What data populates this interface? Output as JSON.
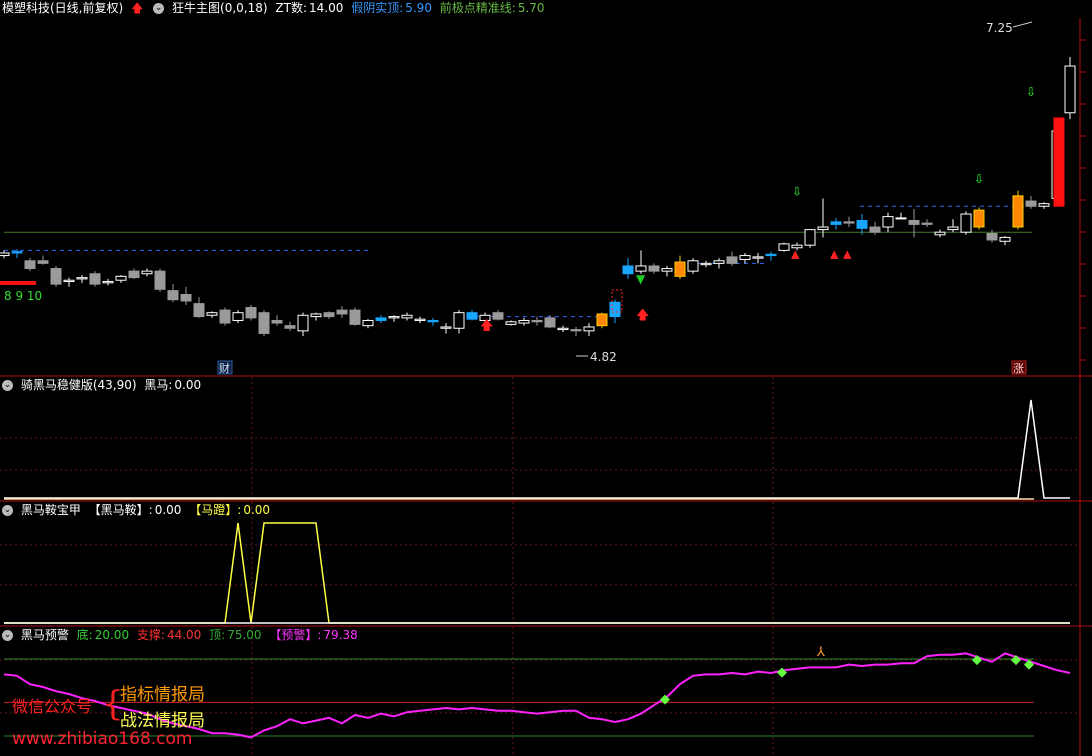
{
  "header": {
    "stock": "模塑科技(日线,前复权)",
    "indicator": "狂牛主图(0,0,18)",
    "zt_label": "ZT数:",
    "zt_value": "14.00",
    "fake_label": "假阴实顶:",
    "fake_value": "5.90",
    "prev_label": "前极点精准线:",
    "prev_value": "5.70"
  },
  "main_pane": {
    "high_label": "7.25",
    "low_label": "4.82",
    "counter": "8 9 10",
    "badge_cai": "财",
    "badge_zhang": "涨",
    "ylim": [
      4.6,
      7.35
    ]
  },
  "pane2": {
    "title": "骑黑马稳健版(43,90)",
    "label": "黑马:",
    "value": "0.00"
  },
  "pane3": {
    "title": "黑马鞍宝甲",
    "label1": "【黑马鞍】:",
    "value1": "0.00",
    "label2": "【马蹬】:",
    "value2": "0.00"
  },
  "pane4": {
    "title": "黑马预警",
    "bottom_label": "底:",
    "bottom_value": "20.00",
    "support_label": "支撑:",
    "support_value": "44.00",
    "top_label": "顶:",
    "top_value": "75.00",
    "warn_label": "【预警】:",
    "warn_value": "79.38"
  },
  "watermark": {
    "wechat": "微信公众号",
    "brace": "{",
    "line1": "指标情报局",
    "line2": "战法情报局",
    "url": "www.zhibiao168.com"
  },
  "colors": {
    "up": "#ffffff",
    "down": "#9a9a9a",
    "hot": "#ff8800",
    "red": "#ff1111",
    "cyan": "#19a6ff",
    "grid": "#6a1a1a",
    "magenta": "#ff22ff",
    "yellow": "#ffff44"
  },
  "chart_data": [
    {
      "type": "candlestick",
      "title": "模塑科技(日线,前复权)",
      "ohlc": [
        [
          5.52,
          5.56,
          5.5,
          5.54
        ],
        [
          5.54,
          5.57,
          5.5,
          5.55
        ],
        [
          5.48,
          5.5,
          5.4,
          5.42
        ],
        [
          5.48,
          5.52,
          5.45,
          5.46
        ],
        [
          5.42,
          5.44,
          5.28,
          5.3
        ],
        [
          5.32,
          5.35,
          5.28,
          5.33
        ],
        [
          5.34,
          5.37,
          5.31,
          5.35
        ],
        [
          5.38,
          5.4,
          5.28,
          5.3
        ],
        [
          5.31,
          5.34,
          5.29,
          5.32
        ],
        [
          5.33,
          5.37,
          5.31,
          5.36
        ],
        [
          5.4,
          5.42,
          5.34,
          5.35
        ],
        [
          5.38,
          5.42,
          5.36,
          5.4
        ],
        [
          5.4,
          5.42,
          5.24,
          5.26
        ],
        [
          5.25,
          5.3,
          5.16,
          5.18
        ],
        [
          5.22,
          5.28,
          5.14,
          5.17
        ],
        [
          5.15,
          5.2,
          5.04,
          5.05
        ],
        [
          5.06,
          5.09,
          5.04,
          5.08
        ],
        [
          5.1,
          5.12,
          4.98,
          5.0
        ],
        [
          5.02,
          5.1,
          5.0,
          5.08
        ],
        [
          5.12,
          5.14,
          5.02,
          5.04
        ],
        [
          5.08,
          5.1,
          4.9,
          4.92
        ],
        [
          5.02,
          5.06,
          4.98,
          5.0
        ],
        [
          4.98,
          5.01,
          4.94,
          4.96
        ],
        [
          4.94,
          5.08,
          4.9,
          5.06
        ],
        [
          5.05,
          5.08,
          5.02,
          5.07
        ],
        [
          5.08,
          5.09,
          5.03,
          5.05
        ],
        [
          5.1,
          5.13,
          5.04,
          5.07
        ],
        [
          5.1,
          5.12,
          4.98,
          4.99
        ],
        [
          4.98,
          5.03,
          4.96,
          5.02
        ],
        [
          5.02,
          5.06,
          5.0,
          5.04
        ],
        [
          5.04,
          5.06,
          5.01,
          5.05
        ],
        [
          5.04,
          5.08,
          5.02,
          5.06
        ],
        [
          5.02,
          5.05,
          5.0,
          5.03
        ],
        [
          5.02,
          5.04,
          4.98,
          5.01
        ],
        [
          4.96,
          5.0,
          4.92,
          4.97
        ],
        [
          4.96,
          5.1,
          4.92,
          5.08
        ],
        [
          5.08,
          5.1,
          5.02,
          5.03
        ],
        [
          5.02,
          5.08,
          4.98,
          5.06
        ],
        [
          5.08,
          5.1,
          5.02,
          5.03
        ],
        [
          4.99,
          5.02,
          4.98,
          5.01
        ],
        [
          5.0,
          5.04,
          4.98,
          5.02
        ],
        [
          5.02,
          5.05,
          4.98,
          5.01
        ],
        [
          5.04,
          5.06,
          4.96,
          4.97
        ],
        [
          4.95,
          4.98,
          4.93,
          4.96
        ],
        [
          4.95,
          4.97,
          4.9,
          4.94
        ],
        [
          4.94,
          5.0,
          4.9,
          4.97
        ],
        [
          4.98,
          5.08,
          4.96,
          5.07
        ],
        [
          5.05,
          5.18,
          5.0,
          5.16
        ],
        [
          5.38,
          5.5,
          5.34,
          5.44
        ],
        [
          5.4,
          5.56,
          5.38,
          5.44
        ],
        [
          5.44,
          5.46,
          5.38,
          5.4
        ],
        [
          5.4,
          5.44,
          5.36,
          5.42
        ],
        [
          5.36,
          5.52,
          5.34,
          5.47
        ],
        [
          5.4,
          5.5,
          5.38,
          5.48
        ],
        [
          5.45,
          5.48,
          5.43,
          5.46
        ],
        [
          5.46,
          5.5,
          5.42,
          5.48
        ],
        [
          5.51,
          5.55,
          5.44,
          5.46
        ],
        [
          5.49,
          5.54,
          5.46,
          5.52
        ],
        [
          5.5,
          5.54,
          5.46,
          5.51
        ],
        [
          5.52,
          5.55,
          5.48,
          5.53
        ],
        [
          5.56,
          5.62,
          5.55,
          5.61
        ],
        [
          5.58,
          5.62,
          5.56,
          5.6
        ],
        [
          5.6,
          5.72,
          5.58,
          5.72
        ],
        [
          5.72,
          5.96,
          5.66,
          5.74
        ],
        [
          5.76,
          5.81,
          5.72,
          5.78
        ],
        [
          5.78,
          5.82,
          5.74,
          5.77
        ],
        [
          5.79,
          5.84,
          5.68,
          5.73
        ],
        [
          5.74,
          5.78,
          5.68,
          5.7
        ],
        [
          5.74,
          5.85,
          5.7,
          5.82
        ],
        [
          5.81,
          5.85,
          5.8,
          5.81
        ],
        [
          5.79,
          5.88,
          5.66,
          5.76
        ],
        [
          5.77,
          5.8,
          5.74,
          5.76
        ],
        [
          5.68,
          5.72,
          5.66,
          5.7
        ],
        [
          5.72,
          5.8,
          5.7,
          5.74
        ],
        [
          5.7,
          5.86,
          5.68,
          5.84
        ],
        [
          5.87,
          5.89,
          5.72,
          5.74
        ],
        [
          5.69,
          5.72,
          5.62,
          5.64
        ],
        [
          5.63,
          5.67,
          5.6,
          5.66
        ],
        [
          5.74,
          6.02,
          5.72,
          5.98
        ],
        [
          5.94,
          5.98,
          5.88,
          5.9
        ],
        [
          5.9,
          5.93,
          5.88,
          5.92
        ],
        [
          5.96,
          6.52,
          5.95,
          6.48
        ],
        [
          6.62,
          7.05,
          6.57,
          6.98
        ]
      ]
    },
    {
      "type": "line",
      "title": "骑黑马稳健版(43,90)",
      "series": [
        {
          "name": "黑马",
          "values": [
            0,
            0,
            0,
            0,
            0,
            0,
            0,
            0,
            0,
            0,
            0,
            0,
            0,
            0,
            0,
            0,
            0,
            0,
            0,
            0,
            0,
            0,
            0,
            0,
            0,
            0,
            0,
            0,
            0,
            0,
            0,
            0,
            0,
            0,
            0,
            0,
            0,
            0,
            0,
            0,
            0,
            0,
            0,
            0,
            0,
            0,
            0,
            0,
            0,
            0,
            0,
            0,
            0,
            0,
            0,
            0,
            0,
            0,
            0,
            0,
            0,
            0,
            0,
            0,
            0,
            0,
            0,
            0,
            0,
            0,
            0,
            0,
            0,
            0,
            0,
            0,
            0,
            0,
            0,
            1,
            0,
            0,
            0
          ]
        }
      ],
      "ylim": [
        0,
        1
      ]
    },
    {
      "type": "line",
      "title": "黑马鞍宝甲",
      "series": [
        {
          "name": "黑马鞍",
          "values": [
            0,
            0,
            0,
            0,
            0,
            0,
            0,
            0,
            0,
            0,
            0,
            0,
            0,
            0,
            0,
            0,
            0,
            0,
            1,
            0,
            1,
            1,
            1,
            1,
            1,
            0,
            0,
            0,
            0,
            0,
            0,
            0,
            0,
            0,
            0,
            0,
            0,
            0,
            0,
            0,
            0,
            0,
            0,
            0,
            0,
            0,
            0,
            0,
            0,
            0,
            0,
            0,
            0,
            0,
            0,
            0,
            0,
            0,
            0,
            0,
            0,
            0,
            0,
            0,
            0,
            0,
            0,
            0,
            0,
            0,
            0,
            0,
            0,
            0,
            0,
            0,
            0,
            0,
            0,
            0,
            0,
            0,
            0
          ]
        },
        {
          "name": "马蹬",
          "values": [
            0,
            0,
            0,
            0,
            0,
            0,
            0,
            0,
            0,
            0,
            0,
            0,
            0,
            0,
            0,
            0,
            0,
            0,
            0,
            0,
            0,
            0,
            0,
            0,
            0,
            0,
            0,
            0,
            0,
            0,
            0,
            0,
            0,
            0,
            0,
            0,
            0,
            0,
            0,
            0,
            0,
            0,
            0,
            0,
            0,
            0,
            0,
            0,
            0,
            0,
            0,
            0,
            0,
            0,
            0,
            0,
            0,
            0,
            0,
            0,
            0,
            0,
            0,
            0,
            0,
            0,
            0,
            0,
            0,
            0,
            0,
            0,
            0,
            0,
            0,
            0,
            0,
            0,
            0,
            0,
            0,
            0,
            0
          ]
        }
      ],
      "ylim": [
        0,
        1
      ]
    },
    {
      "type": "line",
      "title": "黑马预警",
      "series": [
        {
          "name": "预警",
          "values": [
            64,
            63,
            57,
            55,
            52,
            50,
            47,
            45,
            42,
            40,
            38,
            36,
            32,
            29,
            27,
            25,
            22,
            22,
            21,
            19,
            24,
            27,
            32,
            29,
            31,
            33,
            29,
            35,
            33,
            36,
            34,
            37,
            38,
            39,
            40,
            39,
            40,
            39,
            38,
            38,
            37,
            36,
            37,
            38,
            38,
            33,
            32,
            30,
            32,
            36,
            42,
            48,
            57,
            63,
            64,
            64,
            65,
            64,
            66,
            65,
            67,
            68,
            69,
            69,
            69,
            71,
            70,
            71,
            71,
            72,
            72,
            77,
            78,
            78,
            79,
            76,
            73,
            79,
            76,
            73,
            70,
            67,
            65
          ]
        }
      ],
      "levels": {
        "底": 20,
        "支撑": 44,
        "顶": 75
      },
      "ylim": [
        10,
        90
      ]
    }
  ]
}
